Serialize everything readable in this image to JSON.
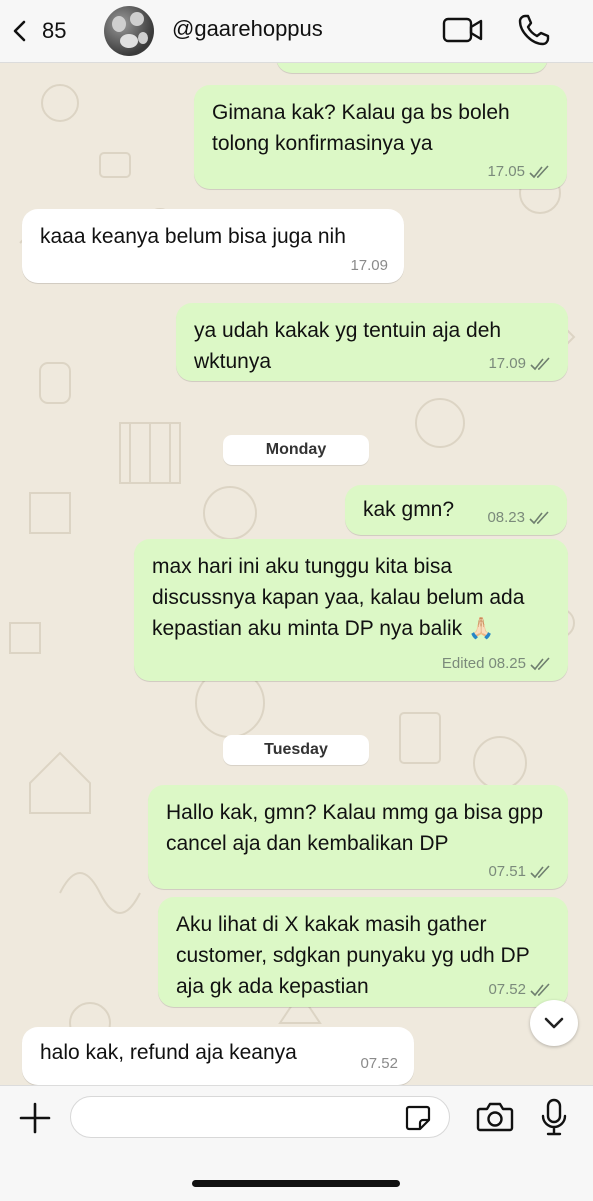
{
  "header": {
    "back_count": "85",
    "contact_name": "@gaarehoppus"
  },
  "day_separators": {
    "monday": "Monday",
    "tuesday": "Tuesday"
  },
  "messages": [
    {
      "direction": "out",
      "text": "Gimana kak? Kalau ga bs boleh tolong konfirmasinya ya",
      "time": "17.05",
      "status": "read"
    },
    {
      "direction": "in",
      "text": "kaaa keanya belum bisa juga nih",
      "time": "17.09"
    },
    {
      "direction": "out",
      "text": "ya udah kakak yg tentuin aja deh wktunya",
      "time": "17.09",
      "status": "read"
    },
    {
      "direction": "out",
      "text": "kak gmn?",
      "time": "08.23",
      "status": "read"
    },
    {
      "direction": "out",
      "text": "max hari ini aku tunggu kita bisa discussnya kapan yaa, kalau belum ada kepastian aku minta DP nya balik 🙏🏻",
      "time": "08.25",
      "edited_label": "Edited",
      "status": "read"
    },
    {
      "direction": "out",
      "text": "Hallo kak, gmn? Kalau mmg ga bisa gpp cancel aja dan kembalikan DP",
      "time": "07.51",
      "status": "read"
    },
    {
      "direction": "out",
      "text": "Aku lihat di X kakak masih gather customer, sdgkan punyaku yg udh DP aja gk ada kepastian",
      "time": "07.52",
      "status": "read"
    },
    {
      "direction": "in",
      "text": "halo kak, refund aja keanya",
      "time": "07.52"
    }
  ],
  "input": {
    "placeholder": ""
  },
  "icons": {
    "back": "chevron-left-icon",
    "video": "video-camera-icon",
    "call": "phone-icon",
    "plus": "plus-icon",
    "sticker": "sticker-icon",
    "camera": "camera-icon",
    "mic": "microphone-icon",
    "scroll": "chevron-down-icon",
    "read_status": "double-check-icon"
  },
  "colors": {
    "outgoing_bubble": "#dcf8c6",
    "incoming_bubble": "#ffffff",
    "chat_background": "#efe9dd",
    "header_background": "#f7f7f7"
  }
}
